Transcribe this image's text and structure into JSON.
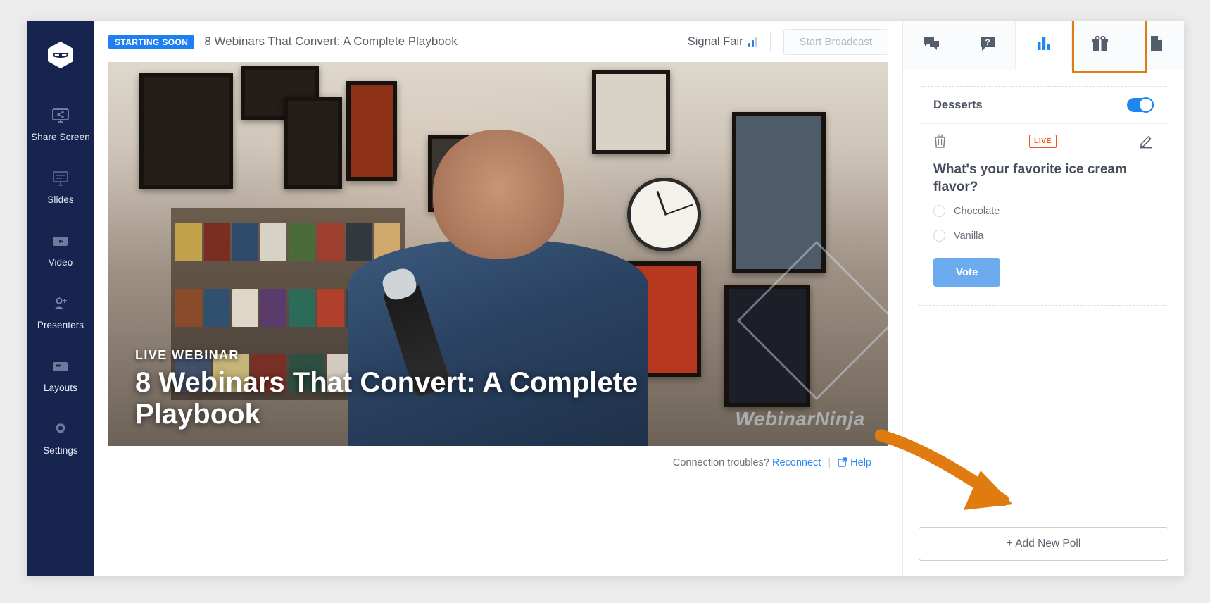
{
  "sidebar": {
    "logo_icon": "ninja-mask-logo",
    "items": [
      {
        "label": "Share Screen",
        "icon": "screen-share-icon"
      },
      {
        "label": "Slides",
        "icon": "presentation-slides-icon"
      },
      {
        "label": "Video",
        "icon": "video-play-icon"
      },
      {
        "label": "Presenters",
        "icon": "add-person-icon"
      },
      {
        "label": "Layouts",
        "icon": "layout-grid-icon"
      },
      {
        "label": "Settings",
        "icon": "gear-icon"
      }
    ]
  },
  "topbar": {
    "status_badge": "STARTING SOON",
    "webinar_title": "8 Webinars That Convert: A Complete Playbook",
    "signal_label": "Signal Fair",
    "signal_icon": "signal-bars-icon",
    "start_broadcast_label": "Start Broadcast",
    "start_broadcast_disabled": true
  },
  "video": {
    "overlay_eyebrow": "LIVE WEBINAR",
    "overlay_title": "8 Webinars That Convert: A Complete Playbook",
    "watermark": "WebinarNinja",
    "footer": {
      "prompt": "Connection troubles?",
      "reconnect_label": "Reconnect",
      "separator": "|",
      "help_label": "Help",
      "help_icon": "external-link-icon"
    }
  },
  "right_panel": {
    "tabs": [
      {
        "name": "chat",
        "icon": "chat-bubbles-icon",
        "active": false
      },
      {
        "name": "qa",
        "icon": "question-bubble-icon",
        "active": false
      },
      {
        "name": "polls",
        "icon": "bar-chart-icon",
        "active": true
      },
      {
        "name": "offers",
        "icon": "gift-icon",
        "active": false
      },
      {
        "name": "handouts",
        "icon": "document-icon",
        "active": false
      }
    ],
    "highlight_color": "#e07b10",
    "poll": {
      "name": "Desserts",
      "enabled": true,
      "status_badge": "LIVE",
      "status_color": "#f4511e",
      "delete_icon": "trash-icon",
      "edit_icon": "pencil-edit-icon",
      "question": "What's your favorite ice cream flavor?",
      "options": [
        {
          "label": "Chocolate",
          "selected": false
        },
        {
          "label": "Vanilla",
          "selected": false
        }
      ],
      "vote_label": "Vote"
    },
    "add_new_poll_label": "+ Add New Poll"
  },
  "colors": {
    "sidebar_bg": "#16244f",
    "accent_blue": "#1d7ff2",
    "vote_blue": "#6cabee",
    "live_red": "#f4511e",
    "annotation_orange": "#e07b10"
  }
}
